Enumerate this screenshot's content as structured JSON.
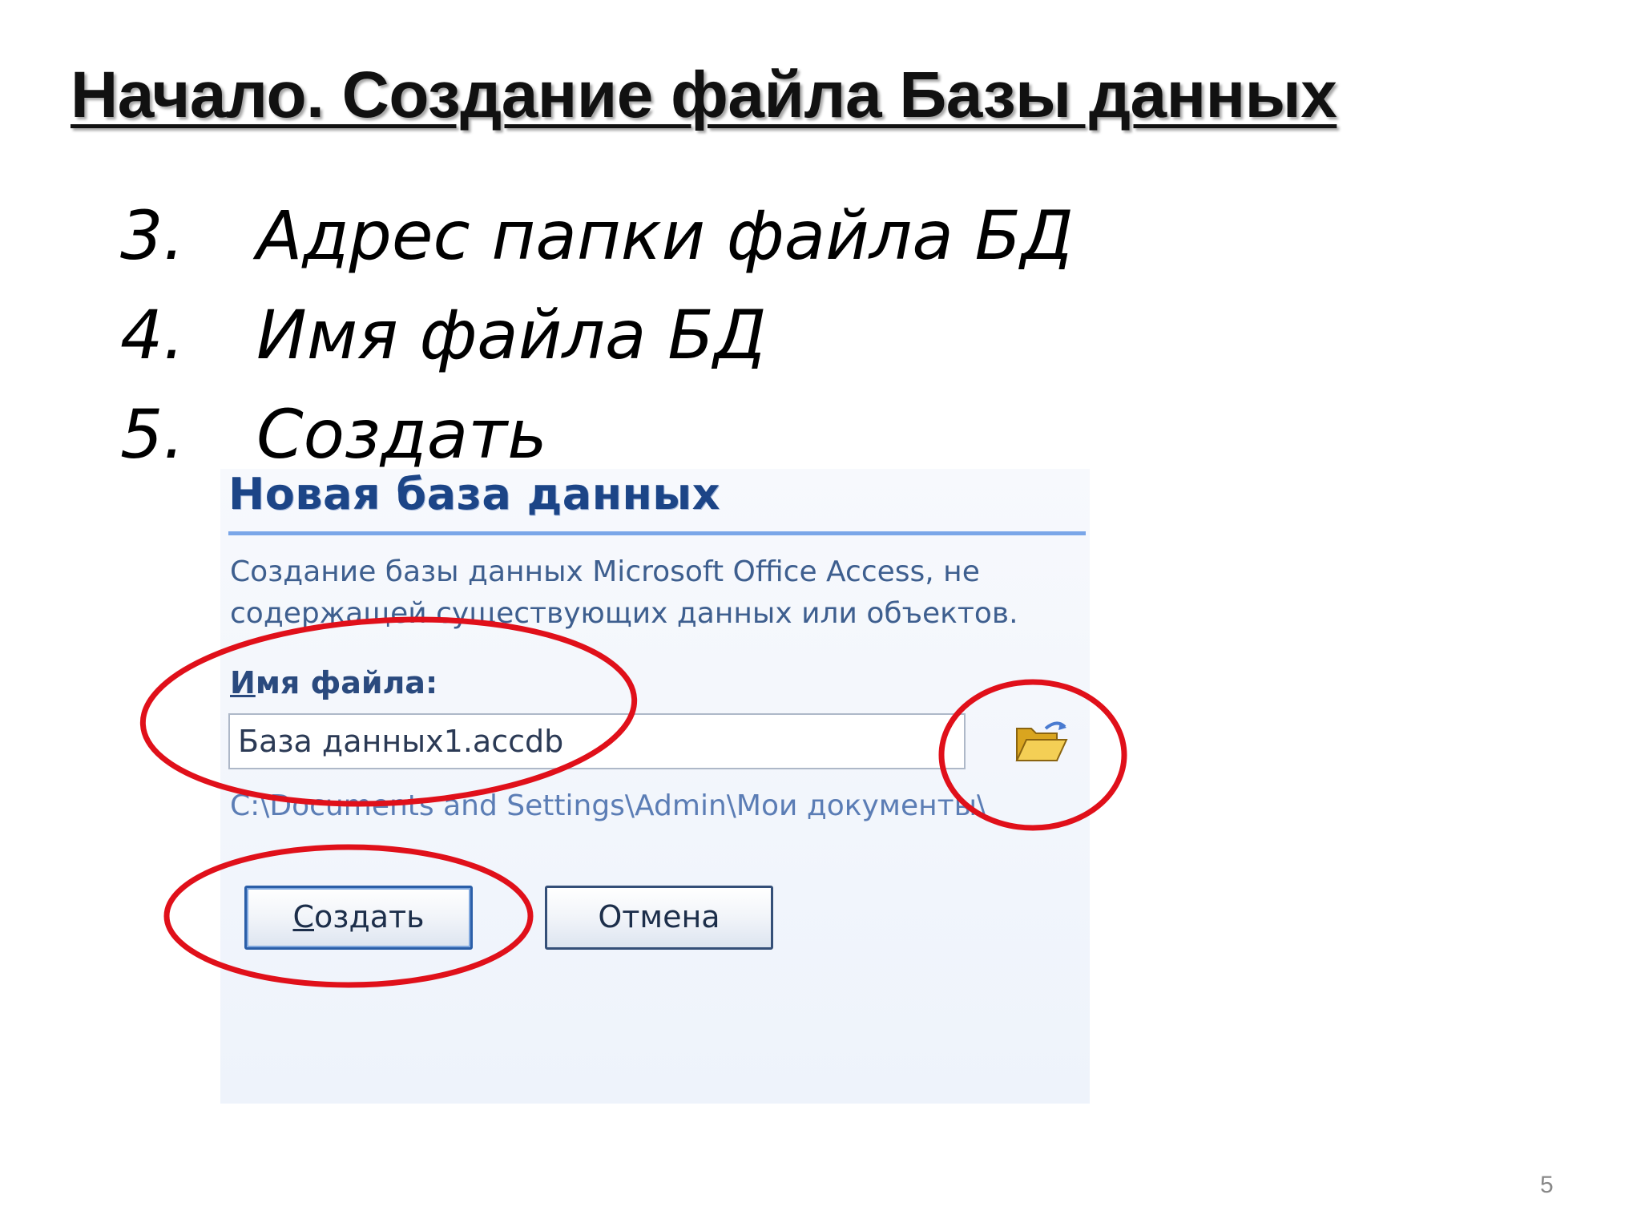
{
  "slide": {
    "title": "Начало. Создание файла Базы данных",
    "steps": [
      {
        "num": "3.",
        "text": "Адрес папки файла БД"
      },
      {
        "num": "4.",
        "text": "Имя файла БД"
      },
      {
        "num": "5.",
        "text": "Создать"
      }
    ],
    "page_number": "5"
  },
  "dialog": {
    "title": "Новая база данных",
    "description": "Создание базы данных Microsoft Office Access, не содержащей существующих данных или объектов.",
    "filename_label_key": "И",
    "filename_label_rest": "мя файла:",
    "filename_value": "База данных1.accdb",
    "path": "C:\\Documents and Settings\\Admin\\Мои документы\\",
    "browse_icon": "folder-open-icon",
    "create_button_key": "С",
    "create_button_rest": "оздать",
    "cancel_button": "Отмена"
  },
  "highlights": {
    "color": "#e0101a"
  },
  "colors": {
    "dialog_title": "#1c4587",
    "dialog_text": "#3e5f8f",
    "path_text": "#5b7db5",
    "title_rule": "#7aa6e8"
  }
}
